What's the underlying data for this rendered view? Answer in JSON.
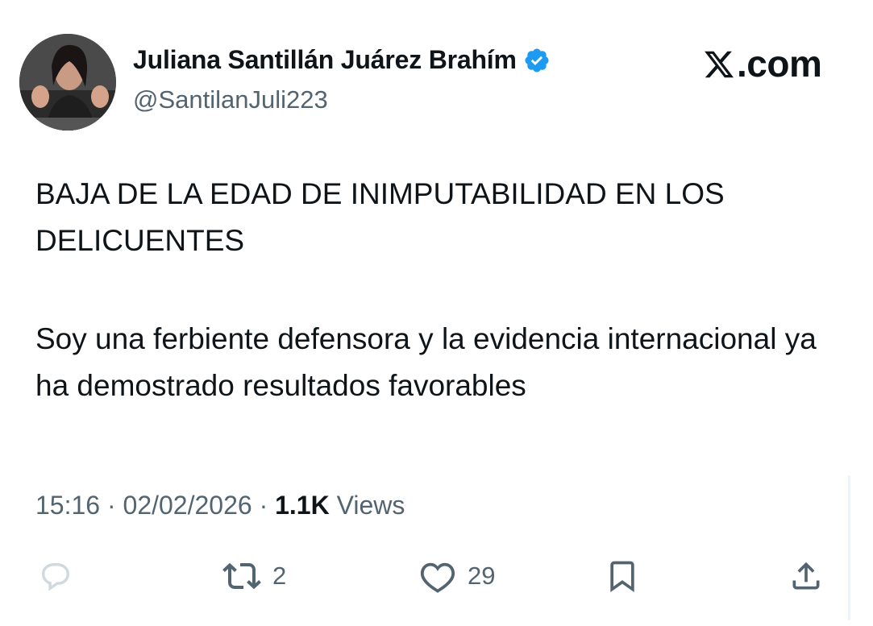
{
  "author": {
    "display_name": "Juliana Santillán Juárez Brahím",
    "handle": "@SantilanJuli223",
    "verified": true,
    "avatar_icon": "profile-photo"
  },
  "brand": {
    "logo_text": ".com",
    "logo_icon": "x-logo-icon"
  },
  "post": {
    "paragraph_1": "BAJA DE LA EDAD DE INIMPUTABILIDAD EN LOS DELICUENTES",
    "paragraph_2": "Soy una ferbiente defensora y la evidencia internacional ya ha demostrado resultados favorables"
  },
  "meta": {
    "time": "15:16",
    "separator": "·",
    "date": "02/02/2026",
    "views_count": "1.1K",
    "views_label": "Views"
  },
  "actions": {
    "reply_icon": "comment-icon",
    "repost_icon": "repost-icon",
    "repost_count": "2",
    "like_icon": "heart-icon",
    "like_count": "29",
    "bookmark_icon": "bookmark-icon",
    "share_icon": "share-icon"
  },
  "colors": {
    "verified_badge": "#1d9bf0",
    "text_primary": "#0f1419",
    "text_secondary": "#536471",
    "reply_icon": "#cfd9de"
  }
}
